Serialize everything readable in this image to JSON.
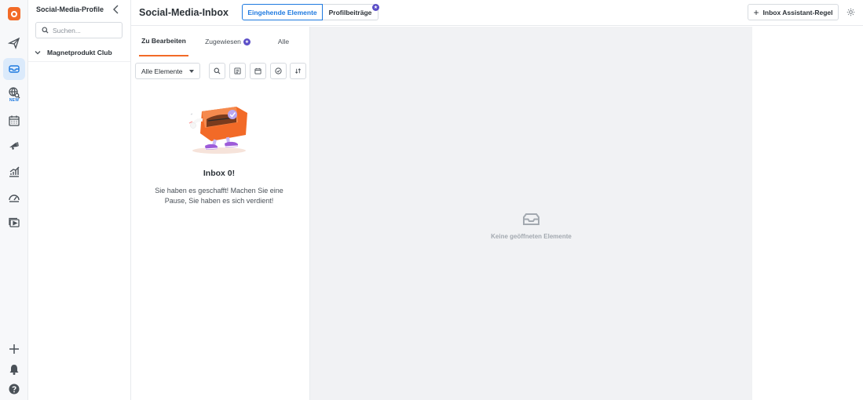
{
  "sidebar_rail": {
    "new_badge": "NEW"
  },
  "profiles": {
    "title": "Social-Media-Profile",
    "search_placeholder": "Suchen...",
    "group_label": "Magnetprodukt Club"
  },
  "header": {
    "title": "Social-Media-Inbox",
    "tab_incoming": "Eingehende Elemente",
    "tab_profile_posts": "Profilbeiträge",
    "rule_button": "Inbox Assistant-Regel"
  },
  "list": {
    "tabs": [
      "Zu Bearbeiten",
      "Zugewiesen",
      "Alle"
    ],
    "filter_value": "Alle Elemente",
    "empty_title": "Inbox 0!",
    "empty_text": "Sie haben es geschafft! Machen Sie eine Pause, Sie haben es sich verdient!"
  },
  "detail": {
    "empty_text": "Keine geöffneten Elemente"
  },
  "colors": {
    "accent_orange": "#f26a27",
    "accent_blue": "#1f7ae0",
    "premium_purple": "#5b4ec7",
    "detail_bg": "#f1f2f4"
  }
}
